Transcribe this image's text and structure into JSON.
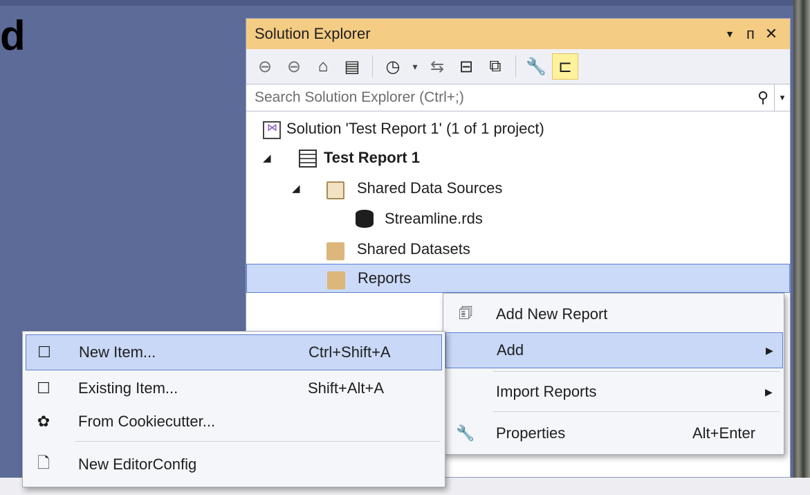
{
  "background_text": "d",
  "panel": {
    "title": "Solution Explorer",
    "title_buttons": {
      "dropdown": "▼",
      "pin": "ᴨ",
      "close": "✕"
    },
    "search_placeholder": "Search Solution Explorer (Ctrl+;)"
  },
  "tree": {
    "solution": "Solution 'Test Report 1' (1 of 1 project)",
    "project": "Test Report 1",
    "shared_data_sources": "Shared Data Sources",
    "streamline": "Streamline.rds",
    "shared_datasets": "Shared Datasets",
    "reports": "Reports"
  },
  "context_menu": {
    "add_new_report": "Add New Report",
    "add": "Add",
    "import_reports": "Import Reports",
    "properties": "Properties",
    "properties_shortcut": "Alt+Enter"
  },
  "add_submenu": {
    "new_item": "New Item...",
    "new_item_shortcut": "Ctrl+Shift+A",
    "existing_item": "Existing Item...",
    "existing_item_shortcut": "Shift+Alt+A",
    "from_cookiecutter": "From Cookiecutter...",
    "new_editorconfig": "New EditorConfig"
  },
  "colors": {
    "background": "#5d6b99",
    "title_bar": "#f5cc84",
    "selection": "#cbdaf8",
    "selection_border": "#5c7fd0"
  }
}
